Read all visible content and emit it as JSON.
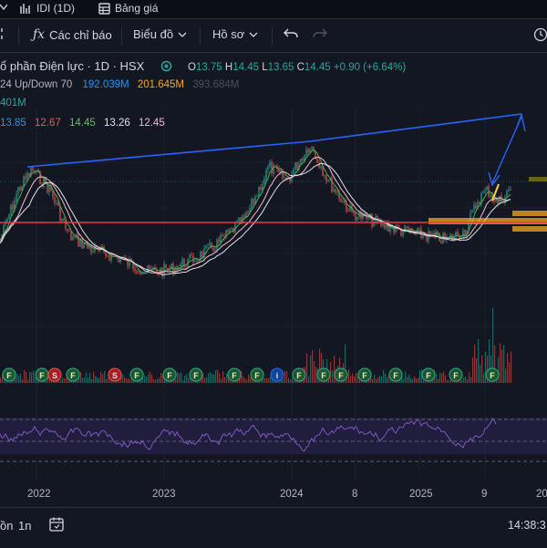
{
  "tabs": {
    "chart_label": "IDI (1D)",
    "price_board_label": "Bảng giá"
  },
  "toolbar": {
    "indicators_label": "Các chỉ báo",
    "chart_type_label": "Biểu đồ",
    "profile_label": "Hồ sơ"
  },
  "legend": {
    "symbol_name": "ổ phần Điện lực · 1D · HSX",
    "ohlc": {
      "o_key": "O",
      "o": "13.75",
      "h_key": "H",
      "h": "14.45",
      "l_key": "L",
      "l": "13.65",
      "c_key": "C",
      "c": "14.45",
      "change": "+0.90 (+6.64%)"
    },
    "volume_line": {
      "label": "24 Up/Down 70",
      "v1": "192.039M",
      "v2": "201.645M",
      "v3": "393.684M"
    },
    "volume_sub": "401M",
    "ma_values": [
      "13.85",
      "12.67",
      "14.45",
      "13.26",
      "12.45"
    ]
  },
  "time_axis": {
    "labels": [
      "2022",
      "2023",
      "2024",
      "8",
      "2025",
      "9",
      "20"
    ]
  },
  "bottom_bar": {
    "range_1": "ồn",
    "range_2": "1n",
    "clock": "14:38:3"
  },
  "colors": {
    "background": "#131722",
    "up": "#26a69a",
    "down": "#ef5350",
    "trendline": "#2962ff",
    "support_line": "#f23645",
    "rsi": "#7e57c2",
    "ma_blue": "#2196f3",
    "ma_red": "#ef5350",
    "ma_green": "#4caf50",
    "ma_white": "#e0e3eb",
    "ma_pink": "#f8bbd0",
    "zone": "#f9a825"
  },
  "markers": [
    "F",
    "F",
    "S",
    "F",
    "S",
    "F",
    "F",
    "F",
    "F",
    "F",
    "i",
    "F",
    "F",
    "F",
    "F",
    "F",
    "F",
    "F",
    "F"
  ]
}
